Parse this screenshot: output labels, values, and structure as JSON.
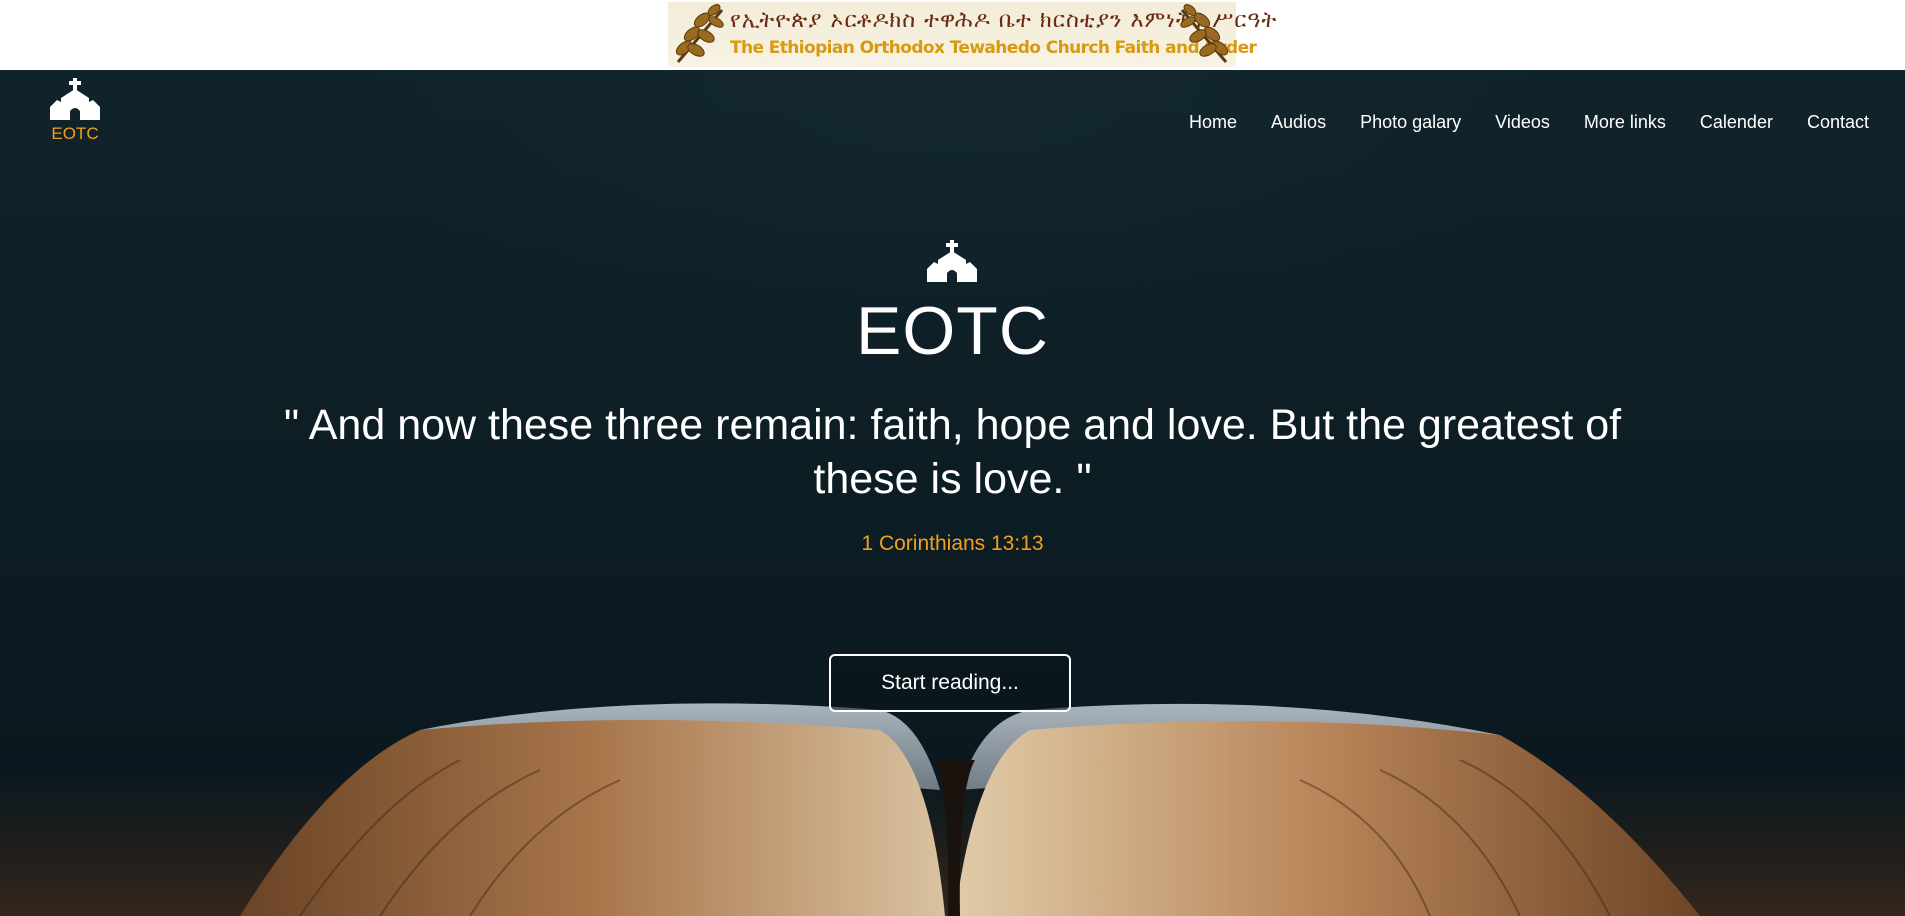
{
  "banner": {
    "amharic": "የኢትዮጵያ ኦርቶዶክስ ተዋሕዶ ቤተ ክርስቲያን እምነትና ሥርዓት",
    "english": "The Ethiopian Orthodox Tewahedo Church Faith and Order"
  },
  "header": {
    "logo_text": "EOTC",
    "logo_icon": "church-icon",
    "nav": [
      {
        "label": "Home"
      },
      {
        "label": "Audios"
      },
      {
        "label": "Photo galary"
      },
      {
        "label": "Videos"
      },
      {
        "label": "More links"
      },
      {
        "label": "Calender"
      },
      {
        "label": "Contact"
      }
    ]
  },
  "hero": {
    "icon": "church-icon",
    "title": "EOTC",
    "quote": "\" And now these three remain: faith, hope and love. But the greatest of these is love. \"",
    "citation": "1 Corinthians 13:13",
    "cta_label": "Start reading..."
  },
  "colors": {
    "accent": "#f0a020",
    "background": "#0d1d24",
    "text": "#ffffff"
  }
}
